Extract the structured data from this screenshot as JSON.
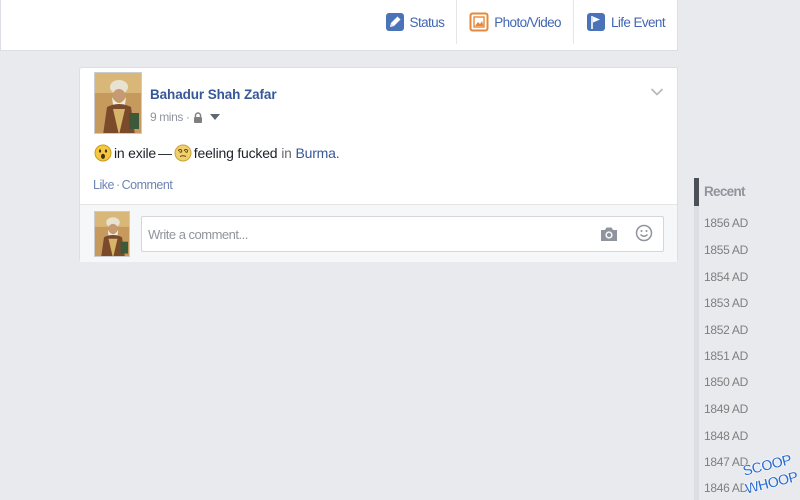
{
  "composer": {
    "tabs": [
      {
        "label": "Status",
        "icon": "pencil-icon"
      },
      {
        "label": "Photo/Video",
        "icon": "photo-icon"
      },
      {
        "label": "Life Event",
        "icon": "flag-icon"
      }
    ]
  },
  "post": {
    "author": "Bahadur Shah Zafar",
    "time": "9 mins ·",
    "privacy_icon": "lock-icon",
    "status": {
      "activity": "in exile",
      "dash": "—",
      "feeling": "feeling fucked",
      "in_word": "in",
      "place": "Burma."
    },
    "actions": {
      "like": "Like",
      "separator": "·",
      "comment": "Comment"
    },
    "comment_box": {
      "placeholder": "Write a comment..."
    }
  },
  "timeline": {
    "recent": "Recent",
    "years": [
      "1856 AD",
      "1855 AD",
      "1854 AD",
      "1853 AD",
      "1852 AD",
      "1851 AD",
      "1850 AD",
      "1849 AD",
      "1848 AD",
      "1847 AD",
      "1846 AD"
    ]
  },
  "watermark": {
    "line1": "SCOOP",
    "line2": "WHOOP"
  },
  "colors": {
    "background": "#e9eaed",
    "link_blue": "#365899",
    "tab_blue": "#4267b2",
    "muted": "#90949c"
  }
}
